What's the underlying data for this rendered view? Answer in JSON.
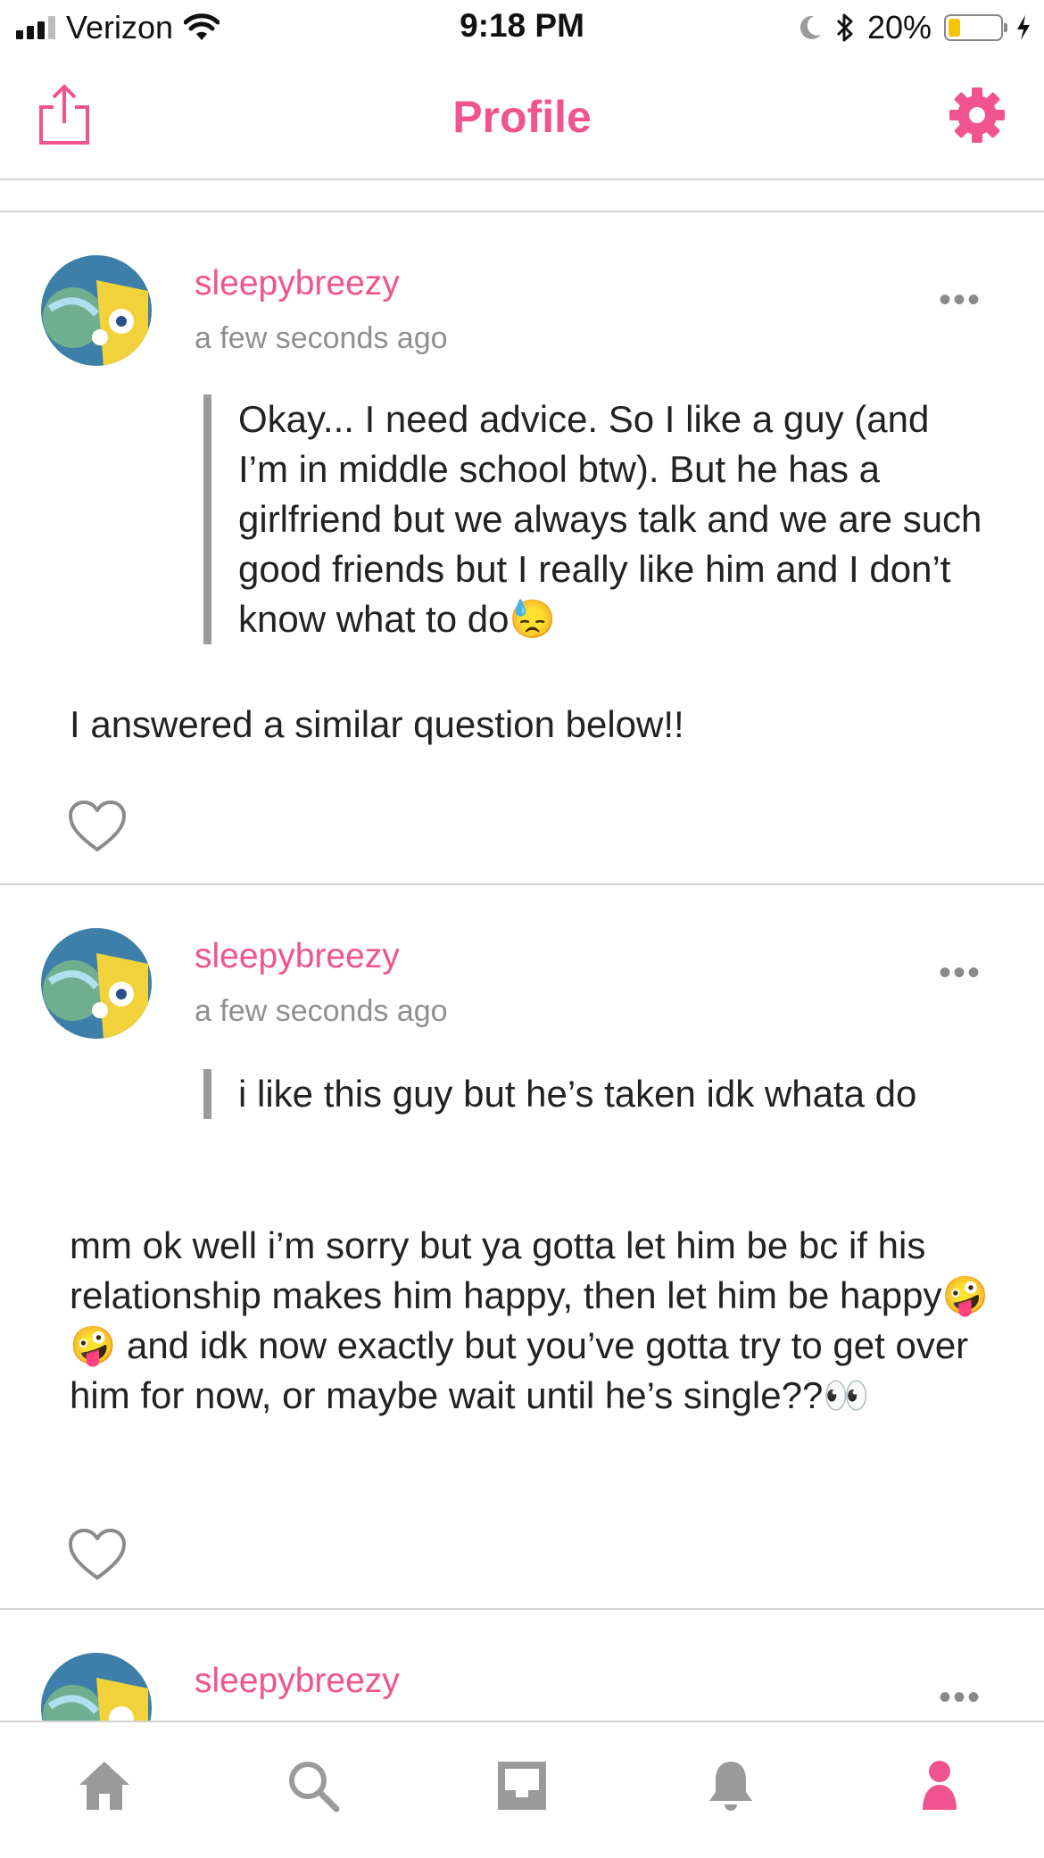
{
  "status_bar": {
    "carrier": "Verizon",
    "time": "9:18 PM",
    "battery_percent": "20%",
    "battery_level": 0.2,
    "icons": [
      "signal-icon",
      "wifi-icon",
      "moon-icon",
      "bluetooth-icon",
      "battery-icon",
      "charging-icon"
    ]
  },
  "header": {
    "title": "Profile",
    "share_icon": "share-icon",
    "settings_icon": "gear-icon"
  },
  "colors": {
    "accent": "#f0548e",
    "divider": "#d2d2d2",
    "quote_bar": "#9b9b9b",
    "muted_text": "#8f8f8f"
  },
  "posts": [
    {
      "username": "sleepybreezy",
      "timestamp": "a few seconds ago",
      "more": "•••",
      "question": "Okay... I need advice. So I like a guy (and I’m in middle school btw). But he has a girlfriend but we always talk and we are such good friends but I really like him and I don’t know what to do😓",
      "answer": "I answered a similar question below!!"
    },
    {
      "username": "sleepybreezy",
      "timestamp": "a few seconds ago",
      "more": "•••",
      "question": "i like this guy but he’s taken idk whata do",
      "answer": "mm ok well i’m sorry but ya gotta let him be bc if his relationship makes him happy, then let him be happy🤪 🤪 and idk now exactly but you’ve gotta try to get over him for now, or maybe wait until he’s single??👀"
    },
    {
      "username": "sleepybreezy",
      "more": "•••"
    }
  ],
  "tab_bar": {
    "tabs": [
      "home-icon",
      "search-icon",
      "inbox-icon",
      "bell-icon",
      "profile-icon"
    ],
    "active": "profile-icon"
  }
}
